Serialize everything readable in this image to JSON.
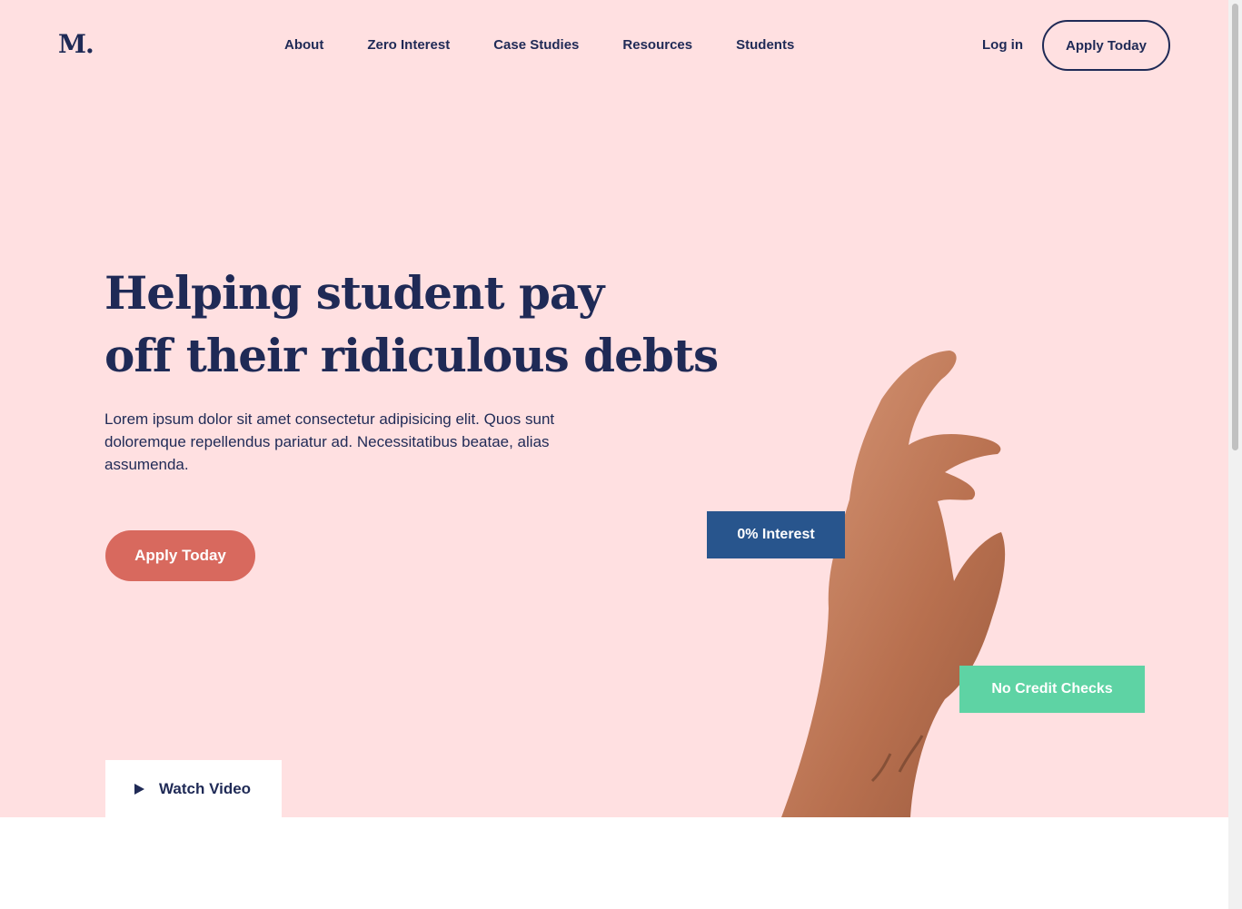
{
  "logo": "M.",
  "nav": [
    "About",
    "Zero Interest",
    "Case Studies",
    "Resources",
    "Students"
  ],
  "header": {
    "login": "Log in",
    "apply": "Apply Today"
  },
  "hero": {
    "headline_line1": "Helping student pay",
    "headline_line2": "off their ridiculous debts",
    "body": "Lorem ipsum dolor sit amet consectetur adipisicing elit. Quos sunt doloremque repellendus pariatur ad. Necessitatibus beatae, alias assumenda.",
    "cta": "Apply Today",
    "watch": "Watch Video"
  },
  "badges": {
    "interest": "0% Interest",
    "credit": "No Credit Checks"
  },
  "colors": {
    "hero_bg": "#ffe0e1",
    "navy": "#1f2a56",
    "coral": "#d8695e",
    "blue": "#28558d",
    "mint": "#5ed3a4"
  }
}
